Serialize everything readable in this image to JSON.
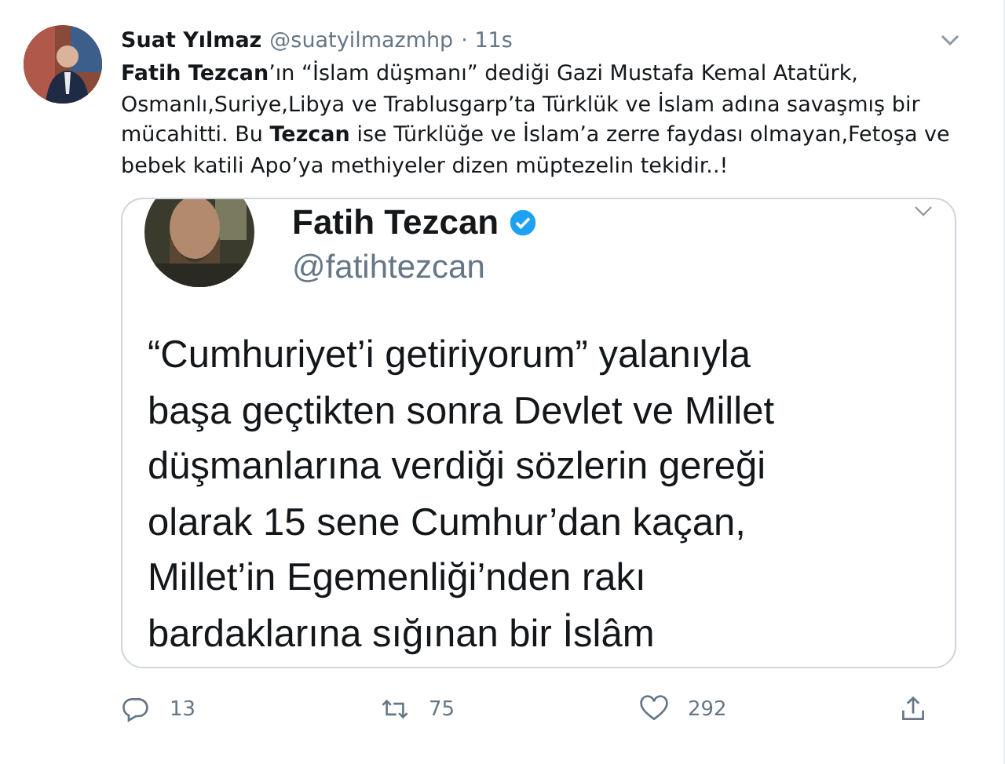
{
  "tweet": {
    "name": "Suat Yılmaz",
    "handle": "@suatyilmazmhp",
    "time": "· 11s",
    "text": "**Fatih Tezcan**’ın “İslam düşmanı” dediği Gazi Mustafa Kemal Atatürk, Osmanlı,Suriye,Libya ve Trablusgarp’ta Türklük ve İslam adına savaşmış bir mücahitti. Bu **Tezcan** ise  Türklüğe ve İslam’a zerre faydası olmayan,Fetoşa ve bebek katili Apo’ya methiyeler dizen müptezelin tekidir..!",
    "embedded": {
      "name": "Fatih Tezcan",
      "verified": true,
      "handle": "@fatihtezcan",
      "lines": [
        "“Cumhuriyet’i getiriyorum” yalanıyla",
        "başa geçtikten sonra Devlet ve Millet",
        "düşmanlarına verdiği sözlerin gereği",
        "olarak 15 sene Cumhur’dan kaçan,",
        "Millet’in Egemenliği’nden rakı",
        "bardaklarına sığınan bir İslâm"
      ]
    },
    "actions": [
      {
        "kind": "reply",
        "count": "13"
      },
      {
        "kind": "retweet",
        "count": "75"
      },
      {
        "kind": "like",
        "count": "292"
      },
      {
        "kind": "share"
      }
    ]
  }
}
